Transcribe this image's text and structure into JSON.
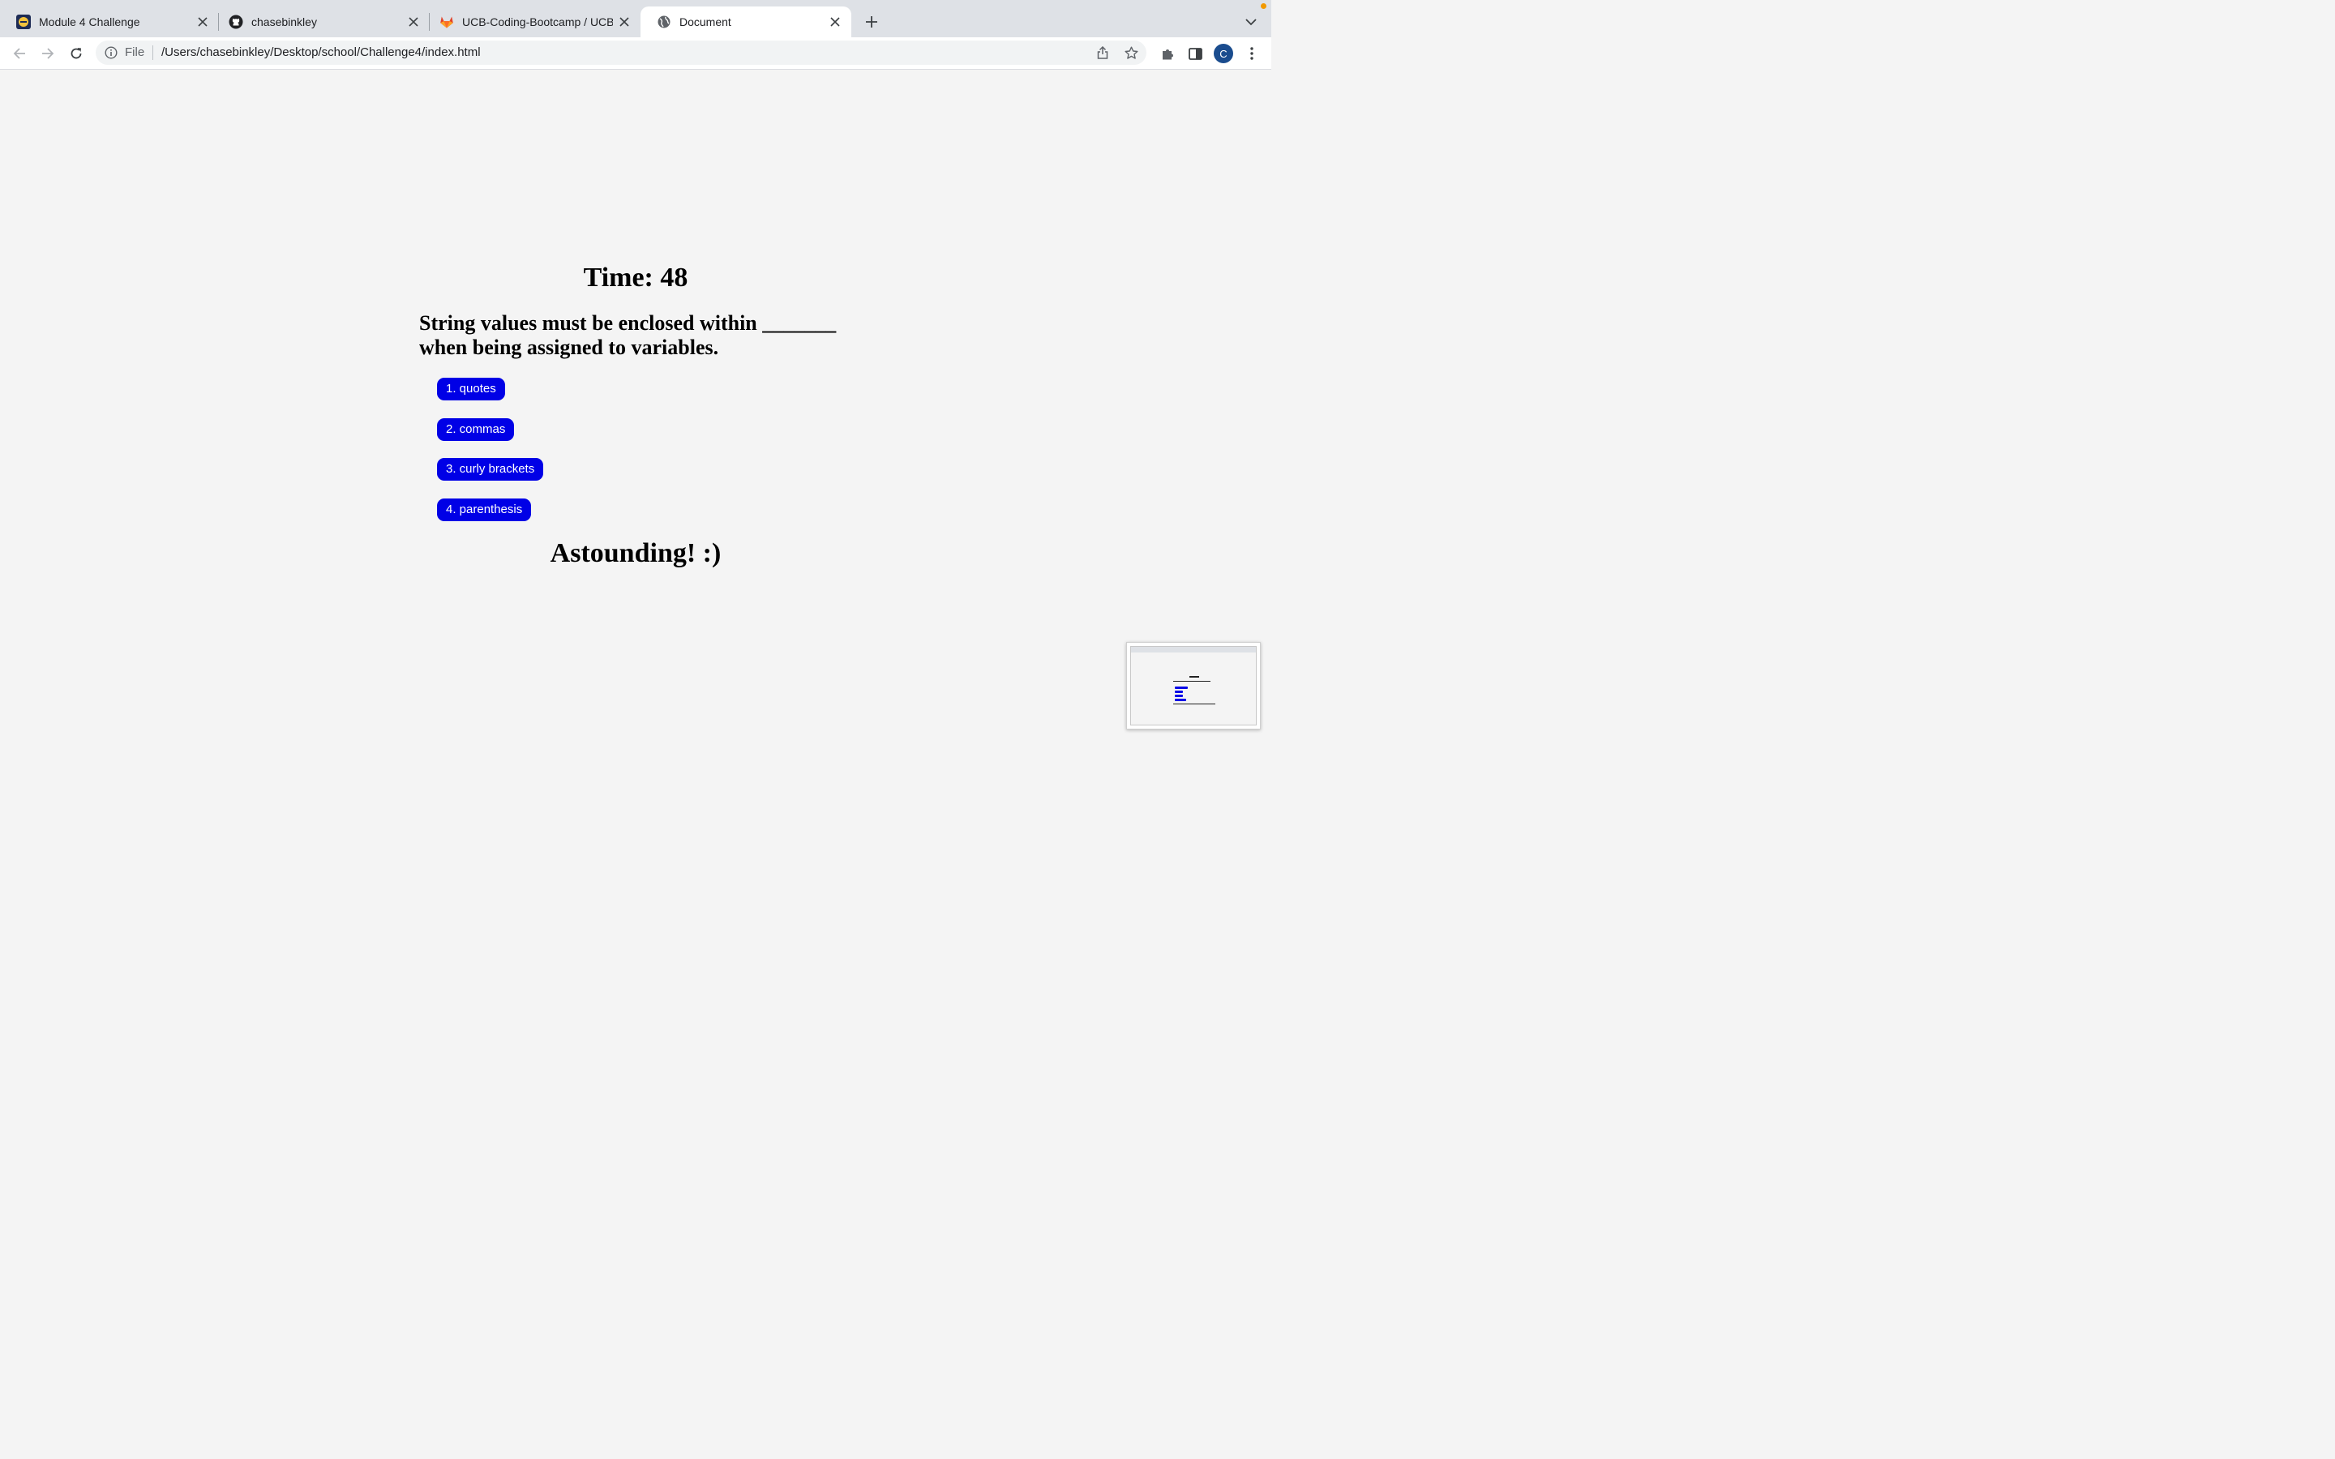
{
  "browser": {
    "tabs": [
      {
        "title": "Module 4 Challenge",
        "favicon": "course-logo-icon"
      },
      {
        "title": "chasebinkley",
        "favicon": "github-icon"
      },
      {
        "title": "UCB-Coding-Bootcamp / UCB-",
        "favicon": "gitlab-icon"
      },
      {
        "title": "Document",
        "favicon": "globe-icon",
        "active": true
      }
    ],
    "address_bar": {
      "scheme_label": "File",
      "url": "/Users/chasebinkley/Desktop/school/Challenge4/index.html"
    },
    "profile_initial": "C"
  },
  "page": {
    "timer": "Time: 48",
    "question": "String values must be enclosed within _______ when being assigned to variables.",
    "answers": [
      "1. quotes",
      "2. commas",
      "3. curly brackets",
      "4. parenthesis"
    ],
    "feedback": "Astounding! :)"
  },
  "colors": {
    "page_background": "#f4f4f4",
    "answer_button": "#0000e6",
    "answer_text": "#ffffff",
    "tabstrip": "#dee1e6"
  }
}
